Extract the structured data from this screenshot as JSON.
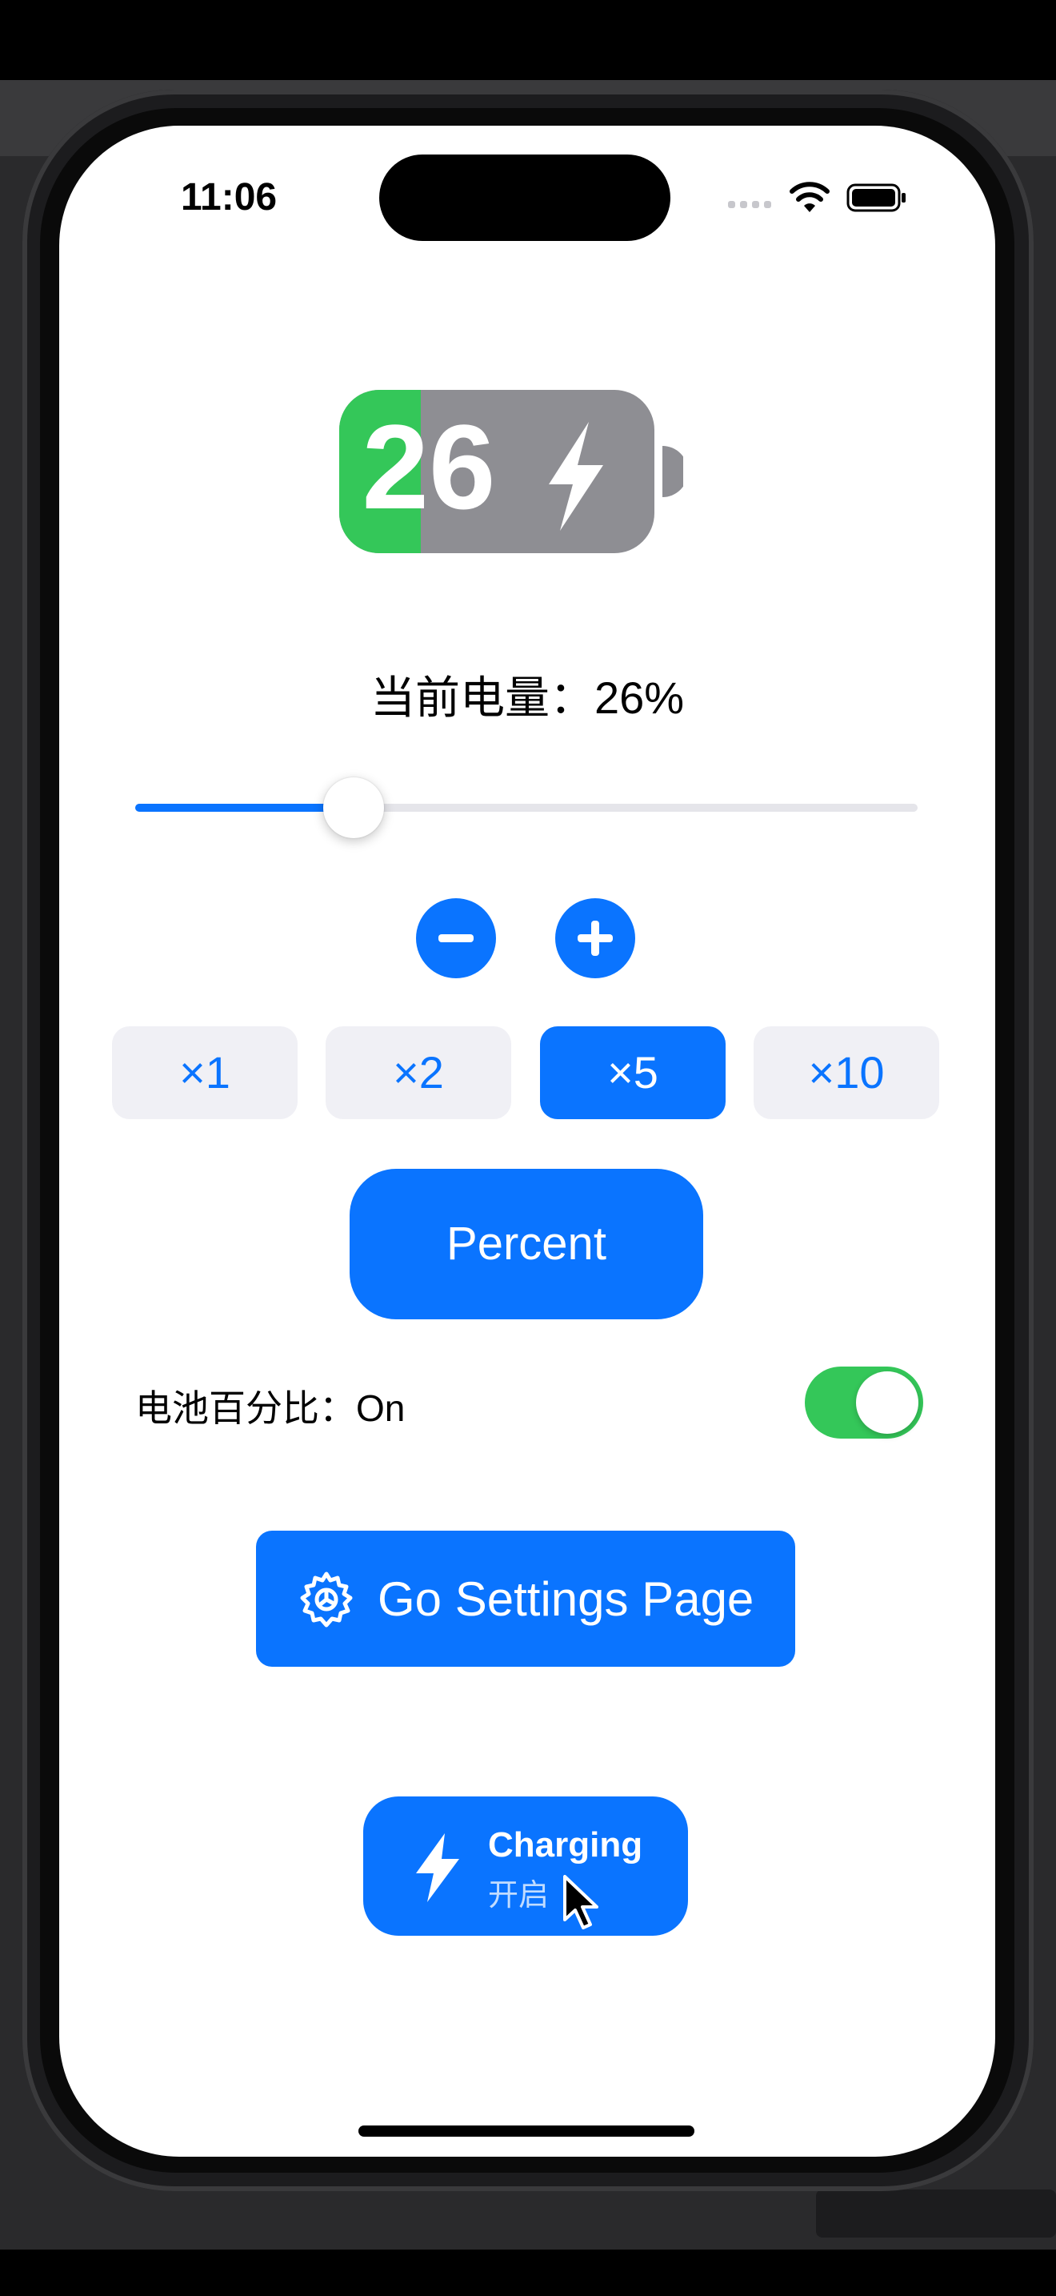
{
  "status_bar": {
    "time": "11:06",
    "wifi_icon": "wifi-icon",
    "battery_icon": "battery-icon"
  },
  "battery_widget": {
    "level": 26,
    "number": "26",
    "fill_color": "#34c759",
    "body_color": "#8e8e93",
    "icon": "bolt-icon"
  },
  "level_text": "当前电量：26%",
  "slider": {
    "value": 0.26,
    "accent": "#0a74ff"
  },
  "stepper": {
    "minus_icon": "minus-icon",
    "plus_icon": "plus-icon"
  },
  "step_options": [
    {
      "label": "×1",
      "selected": false
    },
    {
      "label": "×2",
      "selected": false
    },
    {
      "label": "×5",
      "selected": true
    },
    {
      "label": "×10",
      "selected": false
    }
  ],
  "percent_button": {
    "label": "Percent"
  },
  "percentage_toggle": {
    "label": "电池百分比：On",
    "on": true,
    "on_color": "#34c759"
  },
  "settings_button": {
    "label": "Go Settings Page",
    "icon": "gear-icon"
  },
  "charging_button": {
    "title": "Charging",
    "subtitle": "开启",
    "icon": "bolt-icon"
  },
  "colors": {
    "accent": "#0a74ff",
    "success": "#34c759",
    "segment_bg": "#f0f0f5"
  }
}
